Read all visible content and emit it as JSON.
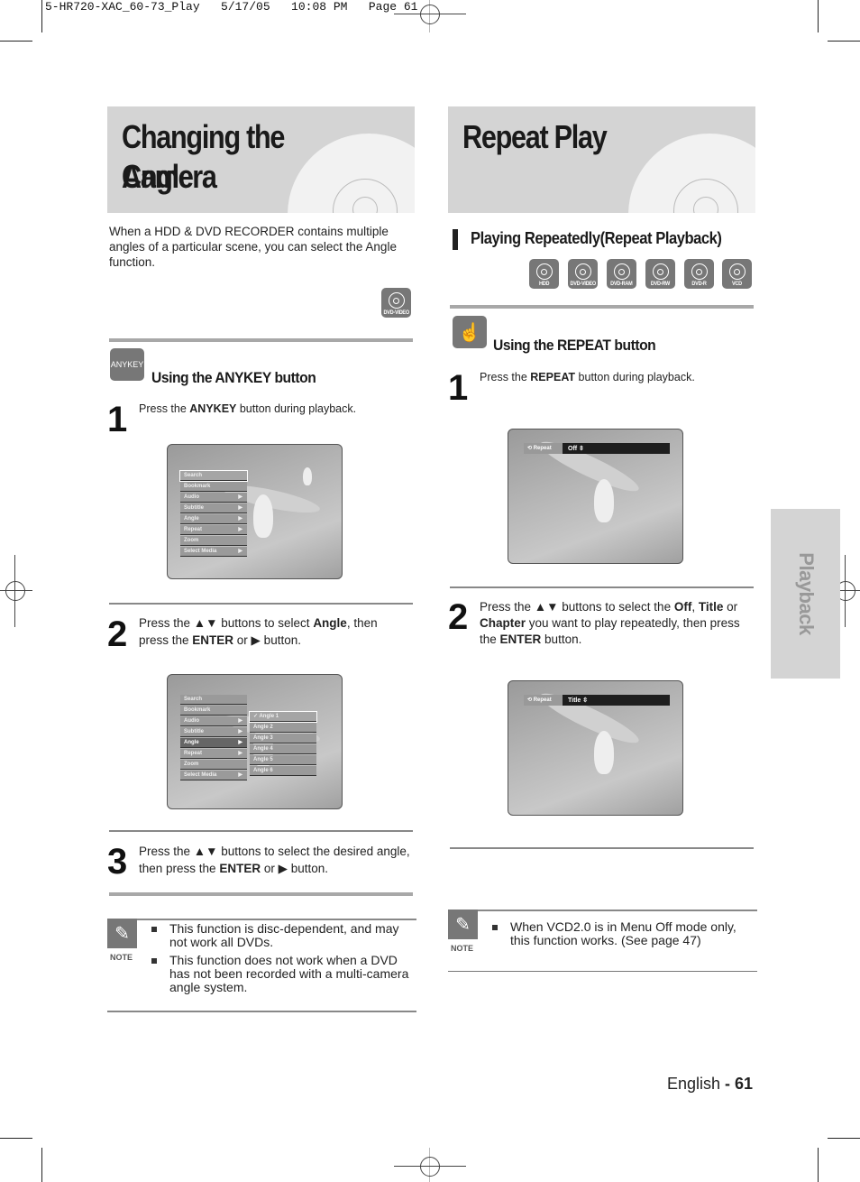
{
  "slug": "5-HR720-XAC_60-73_Play   5/17/05   10:08 PM   Page 61",
  "left": {
    "title_line1": "Changing the Camera",
    "title_line2": "Angle",
    "intro": "When a HDD & DVD RECORDER contains multiple angles of a particular scene, you can select the Angle function.",
    "disc_badge": "DVD-VIDEO",
    "anykey_icon_label": "ANYKEY",
    "subheading": "Using the ANYKEY button",
    "steps": [
      {
        "num": "1",
        "pre": "Press the ",
        "bold1": "ANYKEY",
        "post": " button during playback."
      },
      {
        "num": "2",
        "pre": "Press the ▲▼ buttons to select ",
        "bold1": "Angle",
        "mid": ", then press the ",
        "bold2": "ENTER",
        "post": " or ▶ button."
      },
      {
        "num": "3",
        "pre": "Press the ▲▼ buttons to select the desired angle, then press the ",
        "bold1": "ENTER",
        "post": " or ▶ button."
      }
    ],
    "menu_items": [
      {
        "label": "Search",
        "arrow": ""
      },
      {
        "label": "Bookmark",
        "arrow": ""
      },
      {
        "label": "Audio",
        "arrow": "▶"
      },
      {
        "label": "Subtitle",
        "arrow": "▶"
      },
      {
        "label": "Angle",
        "arrow": "▶"
      },
      {
        "label": "Repeat",
        "arrow": "▶"
      },
      {
        "label": "Zoom",
        "arrow": ""
      },
      {
        "label": "Select Media",
        "arrow": "▶"
      }
    ],
    "angle_items": [
      "✓ Angle 1",
      "Angle 2",
      "Angle 3",
      "Angle 4",
      "Angle 5",
      "Angle 6"
    ],
    "note_label": "NOTE",
    "notes": [
      "This function is disc-dependent, and may not work all DVDs.",
      "This function does not work when a DVD has not been recorded with a multi-camera angle system."
    ]
  },
  "right": {
    "title": "Repeat Play",
    "section_heading": "Playing Repeatedly(Repeat Playback)",
    "disc_badges": [
      "HDD",
      "DVD-VIDEO",
      "DVD-RAM",
      "DVD-RW",
      "DVD-R",
      "VCD"
    ],
    "subheading": "Using the REPEAT button",
    "steps": [
      {
        "num": "1",
        "pre": "Press the ",
        "bold1": "REPEAT",
        "post": " button during playback."
      },
      {
        "num": "2",
        "pre": "Press the ▲▼ buttons to select the ",
        "bold1": "Off",
        "mid1": ", ",
        "bold2": "Title",
        "mid2": " or ",
        "bold3": "Chapter",
        "mid3": " you want to play repeatedly, then press the ",
        "bold4": "ENTER",
        "post": " button."
      }
    ],
    "osd1": {
      "label": "Repeat",
      "value": "Off ⇳"
    },
    "osd2": {
      "label": "Repeat",
      "value": "Title ⇳"
    },
    "note_label": "NOTE",
    "notes": [
      "When VCD2.0 is in Menu Off mode only, this function works. (See page 47)"
    ]
  },
  "side_tab": "Playback",
  "footer": {
    "lang": "English",
    "sep": " - ",
    "page": "61"
  }
}
